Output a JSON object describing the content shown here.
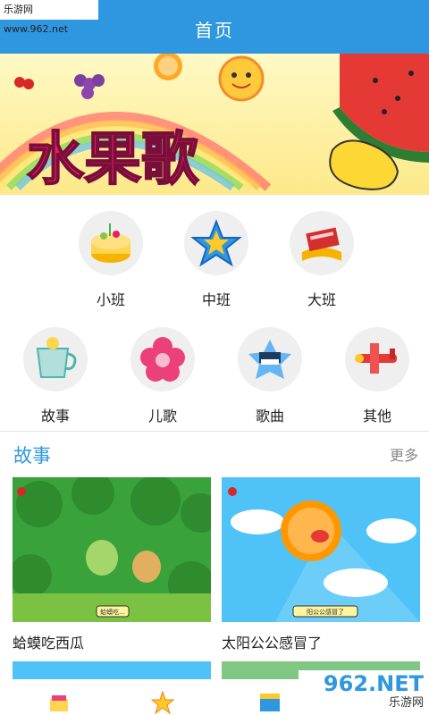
{
  "watermark_top": "乐游网 www.962.net",
  "header": {
    "title": "首页"
  },
  "banner": {
    "title": "水果歌"
  },
  "categories": [
    {
      "label": "小班",
      "icon": "cake-icon"
    },
    {
      "label": "中班",
      "icon": "star-icon"
    },
    {
      "label": "大班",
      "icon": "book-icon"
    },
    {
      "label": "故事",
      "icon": "cup-icon"
    },
    {
      "label": "儿歌",
      "icon": "flower-icon"
    },
    {
      "label": "歌曲",
      "icon": "piano-icon"
    },
    {
      "label": "其他",
      "icon": "plane-icon"
    }
  ],
  "story_section": {
    "title": "故事",
    "more": "更多",
    "items": [
      {
        "caption": "蛤蟆吃西瓜",
        "thumb_label": "蛤蟆吃..."
      },
      {
        "caption": "太阳公公感冒了",
        "thumb_label": "阳公公感冒了"
      }
    ]
  },
  "watermark_bottom": {
    "main": "962.NET",
    "sub": "乐游网"
  },
  "colors": {
    "accent": "#2f97e0",
    "icon_bg": "#efefef"
  }
}
